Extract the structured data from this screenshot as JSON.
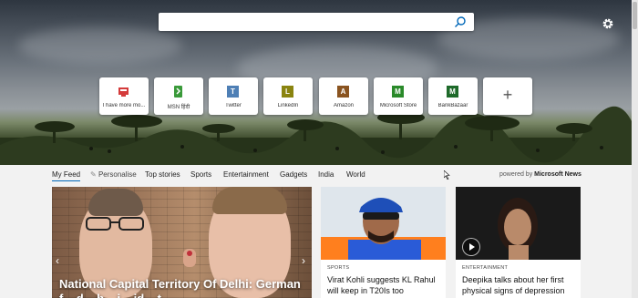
{
  "search": {
    "value": "",
    "placeholder": ""
  },
  "tiles": [
    {
      "label": "I have more mo...",
      "icon": "tv-icon",
      "icon_text": "",
      "color": "#d43b3b"
    },
    {
      "label": "MSN हिंदी",
      "icon": "msn-icon",
      "icon_text": "",
      "color": "#3a9a3a"
    },
    {
      "label": "Twitter",
      "icon": "twitter-icon",
      "icon_text": "T",
      "color": "#4e7fb5"
    },
    {
      "label": "LinkedIn",
      "icon": "linkedin-icon",
      "icon_text": "L",
      "color": "#8a8410"
    },
    {
      "label": "Amazon",
      "icon": "amazon-icon",
      "icon_text": "A",
      "color": "#8a5420"
    },
    {
      "label": "Microsoft Store",
      "icon": "microsoft-store-icon",
      "icon_text": "M",
      "color": "#2a8a2a"
    },
    {
      "label": "BankBazaar",
      "icon": "bankbazaar-icon",
      "icon_text": "M",
      "color": "#1e6a2a"
    }
  ],
  "nav": {
    "items": [
      "My Feed",
      "Personalise",
      "Top stories",
      "Sports",
      "Entertainment",
      "Gadgets",
      "India",
      "World"
    ],
    "active": "My Feed"
  },
  "powered_by": {
    "prefix": "powered by",
    "brand": "Microsoft News"
  },
  "cards": {
    "main": {
      "title": "National Capital Territory Of Delhi: German f... d... b... i... id... t"
    },
    "sports": {
      "category": "SPORTS",
      "title": "Virat Kohli suggests KL Rahul will keep in T20Is too"
    },
    "entertainment": {
      "category": "ENTERTAINMENT",
      "title": "Deepika talks about her first physical signs of depression"
    }
  },
  "colors": {
    "accent": "#0067b8"
  }
}
